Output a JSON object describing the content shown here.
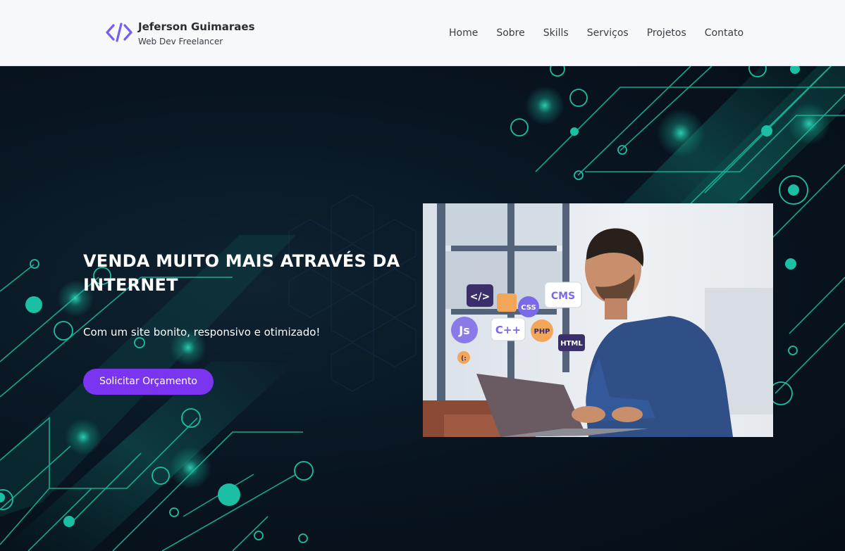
{
  "header": {
    "logo_name": "Jeferson Guimaraes",
    "logo_sub": "Web Dev Freelancer",
    "nav": [
      "Home",
      "Sobre",
      "Skills",
      "Serviços",
      "Projetos",
      "Contato"
    ]
  },
  "hero": {
    "headline": "VENDA MUITO MAIS ATRAVÉS DA INTERNET",
    "tagline": "Com um site bonito, responsivo e otimizado!",
    "cta_label": "Solicitar Orçamento",
    "illustration_bubbles": [
      "</>",
      "CSS",
      "CMS",
      "Js",
      "C++",
      "PHP",
      "HTML",
      "(:"
    ]
  },
  "colors": {
    "accent": "#7b35f0",
    "logo_icon": "#7b5cf0",
    "hero_bg": "#081420",
    "circuit": "#1bbfa3"
  },
  "icons": [
    "code-brackets-icon"
  ]
}
